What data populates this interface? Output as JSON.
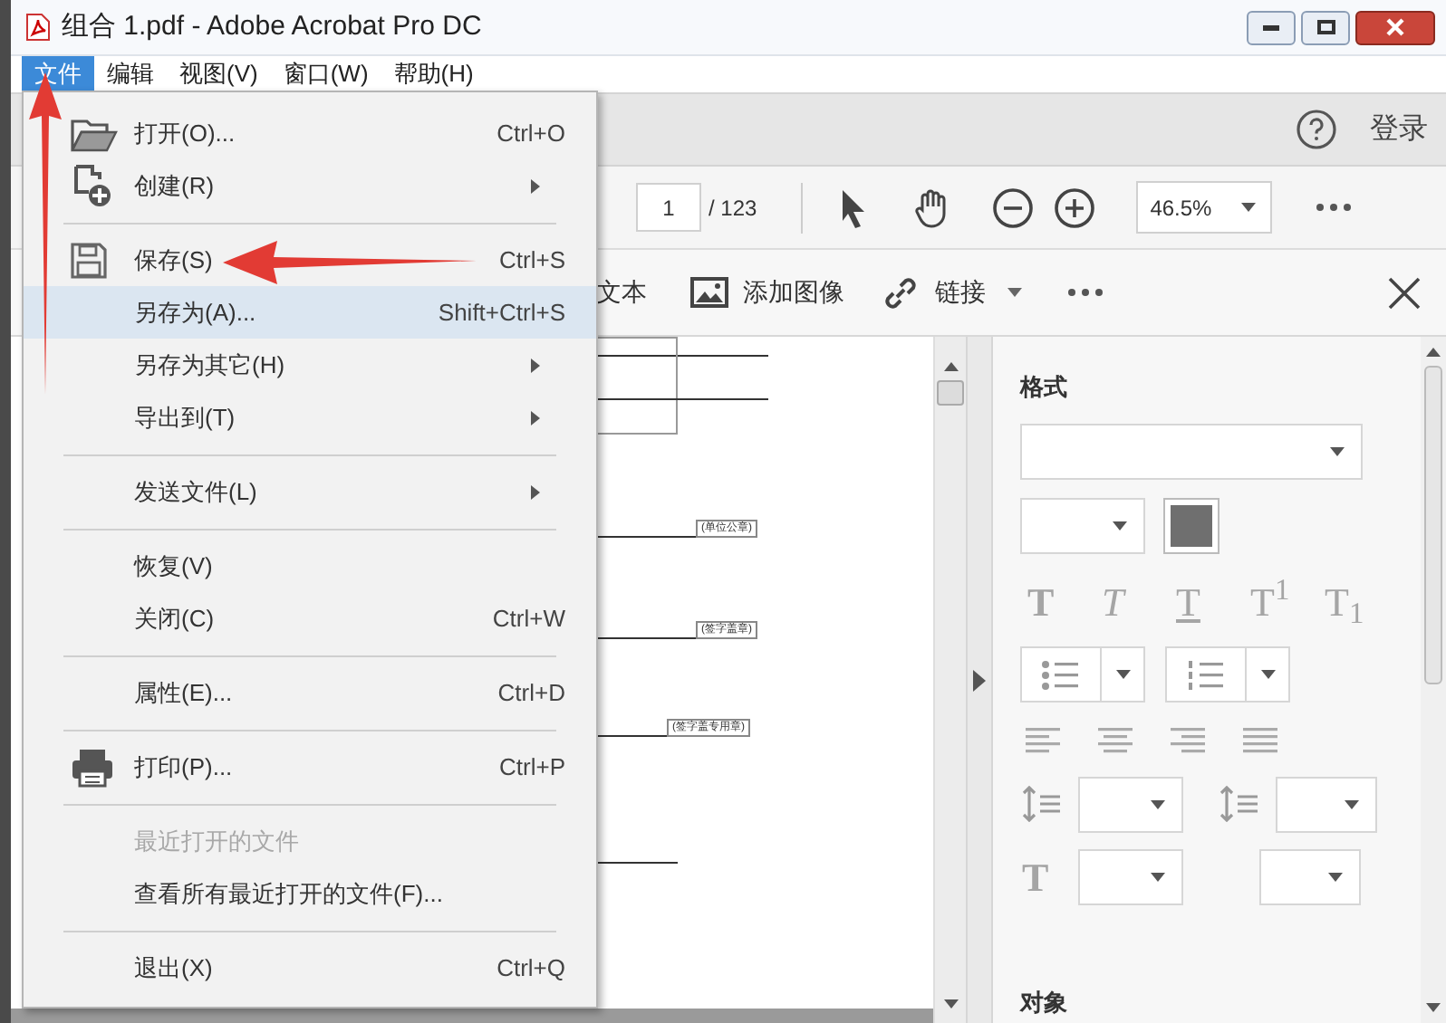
{
  "window": {
    "title": "组合 1.pdf - Adobe Acrobat Pro DC"
  },
  "menu_bar": [
    {
      "label": "文件",
      "selected": true
    },
    {
      "label": "编辑",
      "selected": false
    },
    {
      "label": "视图(V)",
      "selected": false
    },
    {
      "label": "窗口(W)",
      "selected": false
    },
    {
      "label": "帮助(H)",
      "selected": false
    }
  ],
  "header": {
    "sign_in": "登录"
  },
  "toolbar": {
    "page": "1",
    "page_count": "/ 123",
    "zoom": "46.5%"
  },
  "edit_toolbar": {
    "text_tool": "文本",
    "add_image": "添加图像",
    "link": "链接"
  },
  "file_menu": [
    {
      "kind": "folder",
      "label": "打开(O)...",
      "shortcut": "Ctrl+O",
      "submenu": false,
      "selected": false,
      "disabled": false
    },
    {
      "kind": "create",
      "label": "创建(R)",
      "submenu": true,
      "selected": false,
      "disabled": false
    },
    {
      "kind": "separator"
    },
    {
      "kind": "save",
      "label": "保存(S)",
      "shortcut": "Ctrl+S",
      "submenu": false,
      "selected": false,
      "disabled": false
    },
    {
      "kind": "item",
      "label": "另存为(A)...",
      "shortcut": "Shift+Ctrl+S",
      "submenu": false,
      "selected": true,
      "disabled": false
    },
    {
      "kind": "item",
      "label": "另存为其它(H)",
      "submenu": true,
      "selected": false,
      "disabled": false
    },
    {
      "kind": "item",
      "label": "导出到(T)",
      "submenu": true,
      "selected": false,
      "disabled": false
    },
    {
      "kind": "separator"
    },
    {
      "kind": "item",
      "label": "发送文件(L)",
      "submenu": true,
      "selected": false,
      "disabled": false
    },
    {
      "kind": "separator"
    },
    {
      "kind": "item",
      "label": "恢复(V)",
      "submenu": false,
      "selected": false,
      "disabled": false
    },
    {
      "kind": "item",
      "label": "关闭(C)",
      "shortcut": "Ctrl+W",
      "submenu": false,
      "selected": false,
      "disabled": false
    },
    {
      "kind": "separator"
    },
    {
      "kind": "item",
      "label": "属性(E)...",
      "shortcut": "Ctrl+D",
      "submenu": false,
      "selected": false,
      "disabled": false
    },
    {
      "kind": "separator"
    },
    {
      "kind": "print",
      "label": "打印(P)...",
      "shortcut": "Ctrl+P",
      "submenu": false,
      "selected": false,
      "disabled": false
    },
    {
      "kind": "separator"
    },
    {
      "kind": "item",
      "label": "最近打开的文件",
      "submenu": false,
      "selected": false,
      "disabled": true
    },
    {
      "kind": "item",
      "label": "查看所有最近打开的文件(F)...",
      "submenu": false,
      "selected": false,
      "disabled": false
    },
    {
      "kind": "separator"
    },
    {
      "kind": "item",
      "label": "退出(X)",
      "shortcut": "Ctrl+Q",
      "submenu": false,
      "selected": false,
      "disabled": false
    }
  ],
  "document": {
    "stamps": [
      "(单位公章)",
      "(签字盖章)",
      "(签字盖专用章)"
    ]
  },
  "format_panel": {
    "title": "格式",
    "text_styles": [
      {
        "label": "T",
        "kind": "bold"
      },
      {
        "label": "T",
        "kind": "italic"
      },
      {
        "label": "T",
        "kind": "underline"
      },
      {
        "label": "T$^{1}$",
        "kind": "superscript"
      },
      {
        "label": "T$_{1}$",
        "kind": "subscript"
      }
    ],
    "size_label": "T",
    "objects_title": "对象"
  }
}
